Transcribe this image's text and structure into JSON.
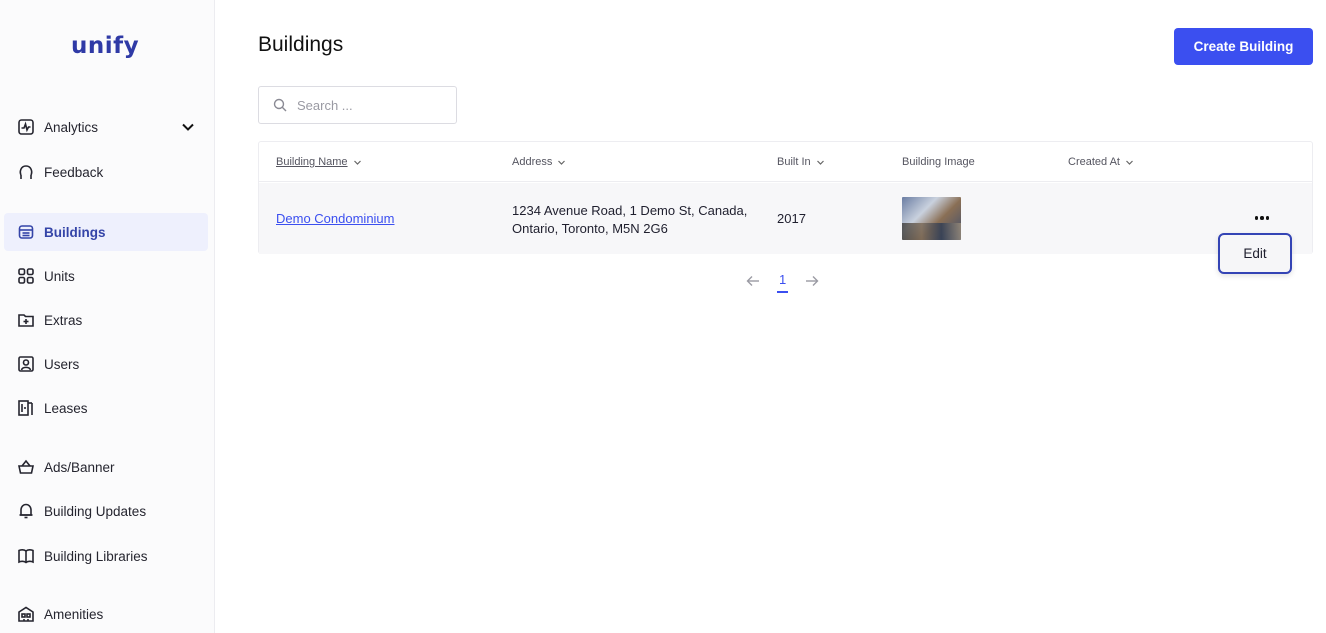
{
  "app": {
    "logo": "unify"
  },
  "sidebar": {
    "items": [
      {
        "label": "Analytics",
        "icon": "analytics-icon"
      },
      {
        "label": "Feedback",
        "icon": "feedback-icon"
      },
      {
        "label": "Buildings",
        "icon": "building-icon",
        "active": true
      },
      {
        "label": "Units",
        "icon": "grid-icon"
      },
      {
        "label": "Extras",
        "icon": "folder-plus-icon"
      },
      {
        "label": "Users",
        "icon": "user-icon"
      },
      {
        "label": "Leases",
        "icon": "lease-icon"
      },
      {
        "label": "Ads/Banner",
        "icon": "basket-icon"
      },
      {
        "label": "Building Updates",
        "icon": "bell-icon"
      },
      {
        "label": "Building Libraries",
        "icon": "book-icon"
      },
      {
        "label": "Amenities",
        "icon": "amenities-icon"
      }
    ]
  },
  "header": {
    "title": "Buildings",
    "create_label": "Create Building"
  },
  "search": {
    "placeholder": "Search ..."
  },
  "table": {
    "columns": [
      "Building Name",
      "Address",
      "Built In",
      "Building Image",
      "Created At"
    ],
    "rows": [
      {
        "name": "Demo Condominium",
        "address_line1": "1234 Avenue Road, 1 Demo St, Canada,",
        "address_line2": "Ontario, Toronto, M5N 2G6",
        "built_in": "2017",
        "created_at": ""
      }
    ]
  },
  "row_menu": {
    "edit_label": "Edit"
  },
  "pagination": {
    "current_page": "1"
  },
  "colors": {
    "accent": "#3b4ff0",
    "active_bg": "#eef0fd",
    "logo": "#2f3aa6"
  }
}
